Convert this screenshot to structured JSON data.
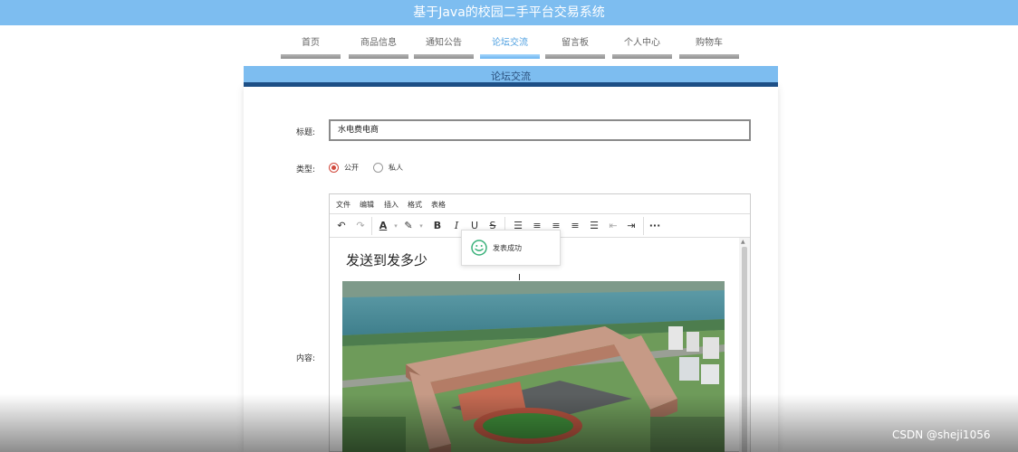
{
  "site": {
    "title": "基于Java的校园二手平台交易系统"
  },
  "nav": {
    "items": [
      {
        "label": "首页"
      },
      {
        "label": "商品信息"
      },
      {
        "label": "通知公告"
      },
      {
        "label": "论坛交流",
        "active": true
      },
      {
        "label": "留言板"
      },
      {
        "label": "个人中心"
      },
      {
        "label": "购物车"
      }
    ]
  },
  "panel": {
    "title": "论坛交流"
  },
  "form": {
    "title_label": "标题:",
    "title_value": "水电费电商",
    "type_label": "类型:",
    "type_options": [
      {
        "label": "公开",
        "checked": true
      },
      {
        "label": "私人",
        "checked": false
      }
    ],
    "content_label": "内容:"
  },
  "editor": {
    "menu": [
      "文件",
      "编辑",
      "插入",
      "格式",
      "表格"
    ],
    "toolbar_icons": [
      "undo-icon",
      "redo-icon",
      "text-color-icon",
      "highlight-icon",
      "bold-icon",
      "italic-icon",
      "underline-icon",
      "strikethrough-icon",
      "bullet-list-icon",
      "align-left-icon",
      "align-center-icon",
      "align-right-icon",
      "align-justify-icon",
      "outdent-icon",
      "indent-icon",
      "more-icon"
    ],
    "content_heading": "发送到发多少"
  },
  "toast": {
    "message": "发表成功",
    "icon": "smile-icon"
  },
  "watermark": "CSDN @sheji1056",
  "colors": {
    "banner": "#7dbdf0",
    "panel_border": "#1d4f86",
    "nav_active": "#4d9fe0",
    "radio_checked": "#d14a3e",
    "toast_icon": "#39b17a"
  }
}
